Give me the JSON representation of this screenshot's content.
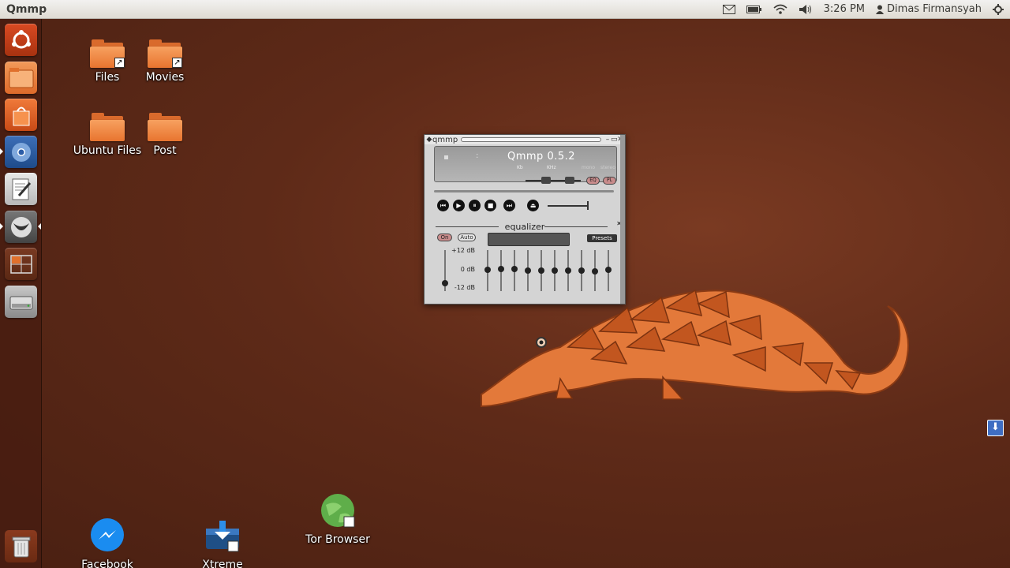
{
  "panel": {
    "app_title": "Qmmp",
    "time": "3:26 PM",
    "user": "Dimas Firmansyah"
  },
  "launcher": {
    "items": [
      {
        "name": "dash-home"
      },
      {
        "name": "files"
      },
      {
        "name": "software-center"
      },
      {
        "name": "chromium"
      },
      {
        "name": "text-editor"
      },
      {
        "name": "qmmp"
      },
      {
        "name": "workspace-switcher"
      },
      {
        "name": "disk-drive"
      }
    ],
    "trash": "trash"
  },
  "desktop": {
    "icons": [
      {
        "label": "Files"
      },
      {
        "label": "Movies"
      },
      {
        "label": "Ubuntu Files"
      },
      {
        "label": "Post"
      },
      {
        "label": "Facebook\nMessenger"
      },
      {
        "label": "Xtreme Download\nManager"
      },
      {
        "label": "Tor Browser"
      }
    ]
  },
  "qmmp": {
    "title": "qmmp",
    "display_title": "Qmmp 0.5.2",
    "kb_label": "Kb",
    "khz_label": "KHz",
    "mono_label": "mono",
    "stereo_label": "stereo",
    "eq_toggle": "EQ",
    "pl_toggle": "PL",
    "eq": {
      "title": "equalizer",
      "on_label": "On",
      "auto_label": "Auto",
      "presets_label": "Presets",
      "db_plus": "+12 dB",
      "db_zero": "0 dB",
      "db_minus": "-12 dB"
    }
  },
  "colors": {
    "accent": "#e8742f",
    "desktop_bg": "#5e2a18",
    "panel_bg": "#dfdbd2"
  }
}
